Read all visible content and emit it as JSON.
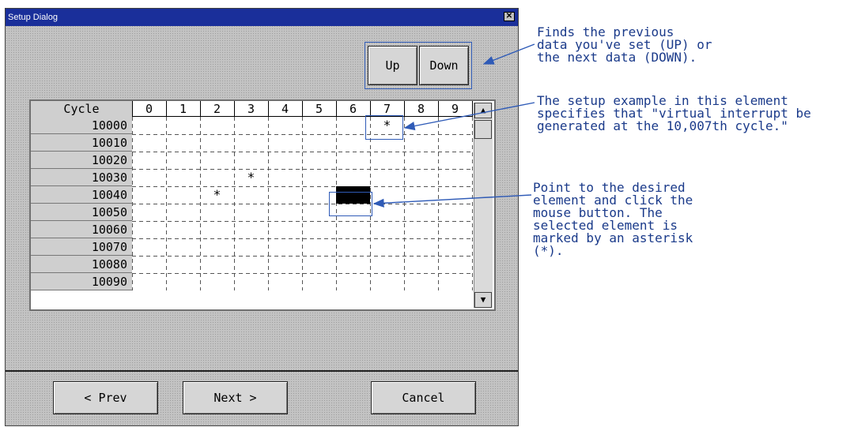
{
  "window": {
    "title": "Setup Dialog",
    "close_glyph": "✕"
  },
  "nav": {
    "up_label": "Up",
    "down_label": "Down"
  },
  "grid": {
    "corner_label": "Cycle",
    "columns": [
      "0",
      "1",
      "2",
      "3",
      "4",
      "5",
      "6",
      "7",
      "8",
      "9"
    ],
    "rows": [
      {
        "label": "10000",
        "cells": [
          "",
          "",
          "",
          "",
          "",
          "",
          "",
          "*",
          "",
          ""
        ]
      },
      {
        "label": "10010",
        "cells": [
          "",
          "",
          "",
          "",
          "",
          "",
          "",
          "",
          "",
          ""
        ]
      },
      {
        "label": "10020",
        "cells": [
          "",
          "",
          "",
          "",
          "",
          "",
          "",
          "",
          "",
          ""
        ]
      },
      {
        "label": "10030",
        "cells": [
          "",
          "",
          "",
          "*",
          "",
          "",
          "",
          "",
          "",
          ""
        ]
      },
      {
        "label": "10040",
        "cells": [
          "",
          "",
          "*",
          "",
          "",
          "",
          "",
          "",
          "",
          ""
        ]
      },
      {
        "label": "10050",
        "cells": [
          "",
          "",
          "",
          "",
          "",
          "",
          "",
          "",
          "",
          ""
        ]
      },
      {
        "label": "10060",
        "cells": [
          "",
          "",
          "",
          "",
          "",
          "",
          "",
          "",
          "",
          ""
        ]
      },
      {
        "label": "10070",
        "cells": [
          "",
          "",
          "",
          "",
          "",
          "",
          "",
          "",
          "",
          ""
        ]
      },
      {
        "label": "10080",
        "cells": [
          "",
          "",
          "",
          "",
          "",
          "",
          "",
          "",
          "",
          ""
        ]
      },
      {
        "label": "10090",
        "cells": [
          "",
          "",
          "",
          "",
          "",
          "",
          "",
          "",
          "",
          ""
        ]
      }
    ],
    "selected_cell": {
      "row": "10040",
      "column": "6"
    }
  },
  "scrollbar": {
    "up_glyph": "▲",
    "down_glyph": "▼"
  },
  "footer": {
    "prev_label": "< Prev",
    "next_label": "Next >",
    "cancel_label": "Cancel"
  },
  "annotations": {
    "updown": "Finds the previous\ndata you've set (UP) or\nthe next data (DOWN).",
    "example": "The setup example in this element\nspecifies that \"virtual interrupt be\ngenerated at the 10,007th cycle.\"",
    "select": "Point to the desired\nelement and click the\nmouse button. The\nselected element is\nmarked by an asterisk\n(*)."
  },
  "colors": {
    "title_bar": "#1a2f9a",
    "annotation": "#1a3a8a"
  }
}
